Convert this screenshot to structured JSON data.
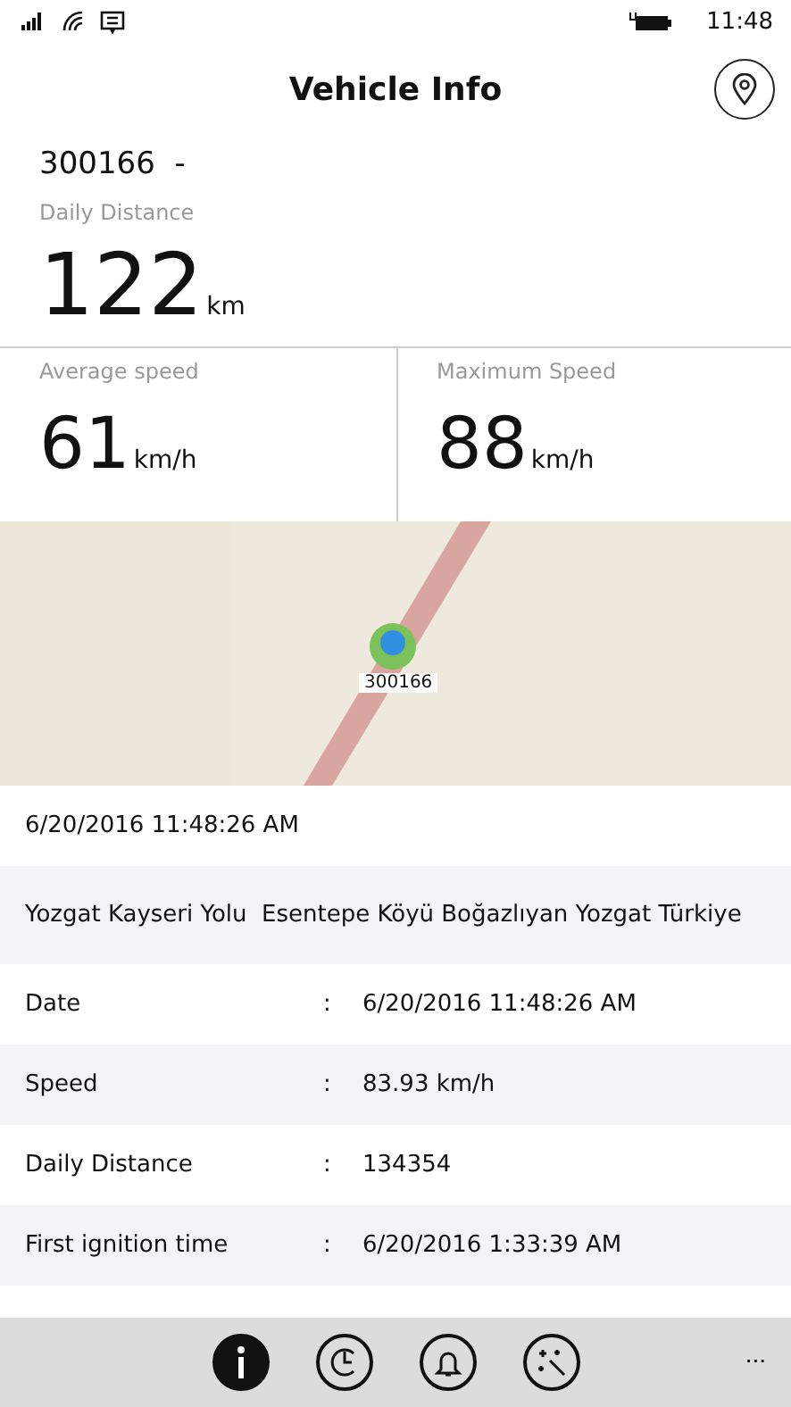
{
  "status_bar": {
    "time": "11:48"
  },
  "header": {
    "title": "Vehicle Info"
  },
  "vehicle": {
    "id": "300166  -",
    "daily_distance_label": "Daily Distance",
    "daily_distance_value": "122",
    "daily_distance_unit": "km"
  },
  "stats": [
    {
      "label": "Average speed",
      "value": "61",
      "unit": "km/h"
    },
    {
      "label": "Maximum Speed",
      "value": "88",
      "unit": "km/h"
    }
  ],
  "map": {
    "kind": "picture",
    "marker_label": "300166"
  },
  "timestamp": "6/20/2016 11:48:26 AM",
  "address": "Yozgat Kayseri Yolu  Esentepe Köyü Boğazlıyan Yozgat Türkiye",
  "details": [
    {
      "label": "Date",
      "separator": ":",
      "value": "6/20/2016 11:48:26 AM"
    },
    {
      "label": "Speed",
      "separator": ":",
      "value": "83.93 km/h"
    },
    {
      "label": "Daily Distance",
      "separator": ":",
      "value": "134354"
    },
    {
      "label": "First ignition time",
      "separator": ":",
      "value": "6/20/2016 1:33:39 AM"
    }
  ],
  "app_bar": {
    "buttons": [
      {
        "kind": "info",
        "selected": true
      },
      {
        "kind": "history",
        "selected": false
      },
      {
        "kind": "alarm",
        "selected": false
      },
      {
        "kind": "magic",
        "selected": false
      }
    ],
    "more": "..."
  }
}
